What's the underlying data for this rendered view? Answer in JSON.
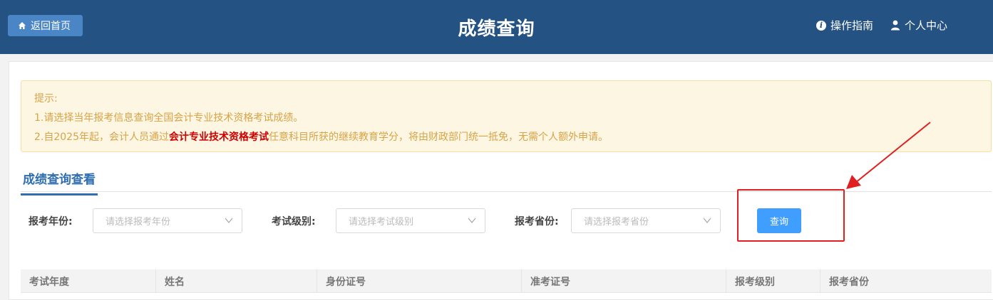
{
  "header": {
    "home_label": "返回首页",
    "title": "成绩查询",
    "guide_label": "操作指南",
    "profile_label": "个人中心",
    "icons": [
      "home-icon",
      "info-icon",
      "user-icon"
    ]
  },
  "tip": {
    "title": "提示:",
    "line1": "1.请选择当年报考信息查询全国会计专业技术资格考试成绩。",
    "line2_prefix": "2.自2025年起，会计人员通过",
    "line2_highlight": "会计专业技术资格考试",
    "line2_suffix": "任意科目所获的继续教育学分，将由财政部门统一抵免，无需个人额外申请。"
  },
  "section": {
    "title": "成绩查询查看"
  },
  "filters": {
    "year_label": "报考年份:",
    "year_placeholder": "请选择报考年份",
    "level_label": "考试级别:",
    "level_placeholder": "请选择考试级别",
    "province_label": "报考省份:",
    "province_placeholder": "请选择报考省份",
    "query_label": "查询"
  },
  "table": {
    "columns": [
      "考试年度",
      "姓名",
      "身份证号",
      "准考证号",
      "报考级别",
      "报考省份"
    ]
  },
  "colors": {
    "header_bg": "#245282",
    "accent": "#409eff",
    "tip_text": "#d9a347",
    "highlight": "#d10000",
    "annotation": "#e02020"
  }
}
